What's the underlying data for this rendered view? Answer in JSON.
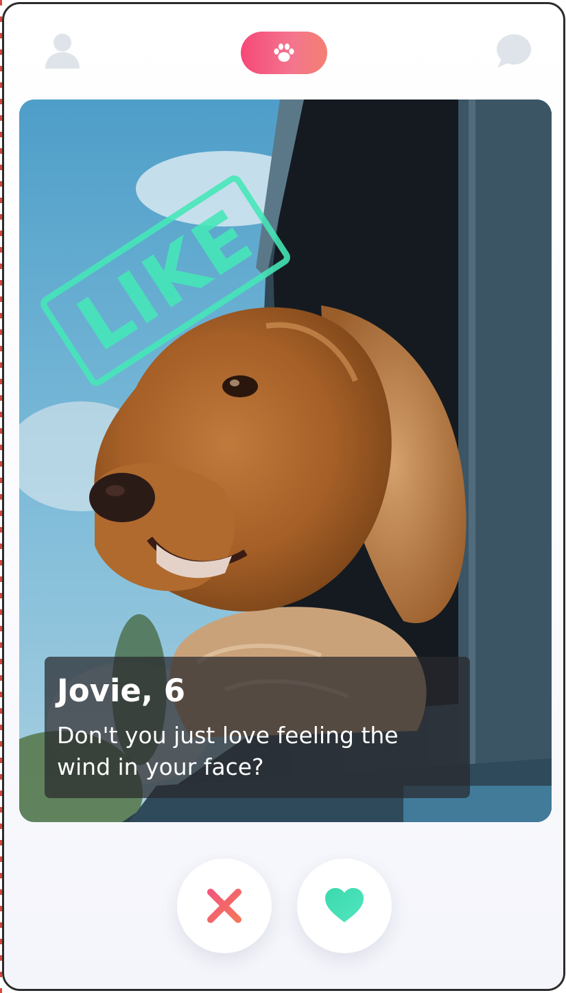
{
  "header": {
    "profile_icon": "profile-icon",
    "center_icon": "paw-icon",
    "chat_icon": "chat-bubble-icon",
    "accent_gradient": [
      "#f64877",
      "#f47f72"
    ]
  },
  "card": {
    "stamp_label": "LIKE",
    "stamp_color": "#45e8b8",
    "name": "Jovie, 6",
    "bio": "Don't you just love feeling the wind in your face?",
    "photo": "dog-in-car-window-photo"
  },
  "actions": {
    "nope_icon": "close-icon",
    "nope_color": "#f3566b",
    "like_icon": "heart-icon",
    "like_color": "#45e8b8"
  }
}
